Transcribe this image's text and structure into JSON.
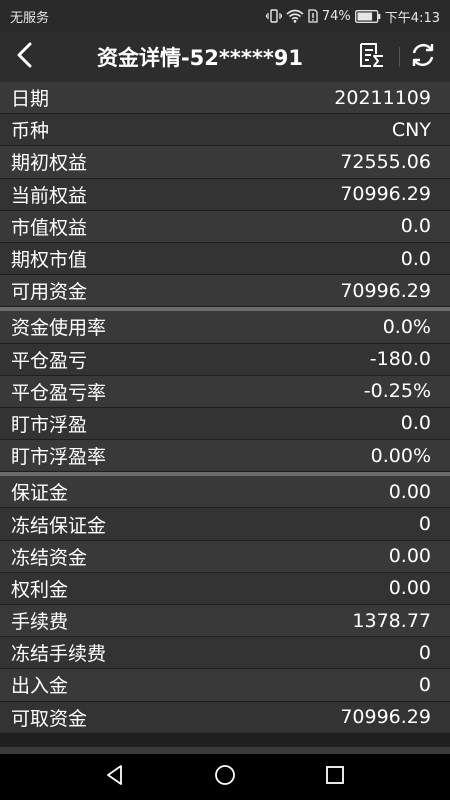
{
  "status_bar": {
    "carrier": "无服务",
    "battery": "74%",
    "time": "下午4:13"
  },
  "header": {
    "title": "资金详情-52*****91"
  },
  "sections": [
    {
      "rows": [
        {
          "label": "日期",
          "value": "20211109"
        },
        {
          "label": "币种",
          "value": "CNY"
        },
        {
          "label": "期初权益",
          "value": "72555.06"
        },
        {
          "label": "当前权益",
          "value": "70996.29"
        },
        {
          "label": "市值权益",
          "value": "0.0"
        },
        {
          "label": "期权市值",
          "value": "0.0"
        },
        {
          "label": "可用资金",
          "value": "70996.29"
        }
      ]
    },
    {
      "rows": [
        {
          "label": "资金使用率",
          "value": "0.0%"
        },
        {
          "label": "平仓盈亏",
          "value": "-180.0"
        },
        {
          "label": "平仓盈亏率",
          "value": "-0.25%"
        },
        {
          "label": "盯市浮盈",
          "value": "0.0"
        },
        {
          "label": "盯市浮盈率",
          "value": "0.00%"
        }
      ]
    },
    {
      "rows": [
        {
          "label": "保证金",
          "value": "0.00"
        },
        {
          "label": "冻结保证金",
          "value": "0"
        },
        {
          "label": "冻结资金",
          "value": "0.00"
        },
        {
          "label": "权利金",
          "value": "0.00"
        },
        {
          "label": "手续费",
          "value": "1378.77"
        },
        {
          "label": "冻结手续费",
          "value": "0"
        },
        {
          "label": "出入金",
          "value": "0"
        },
        {
          "label": "可取资金",
          "value": "70996.29"
        }
      ]
    }
  ]
}
